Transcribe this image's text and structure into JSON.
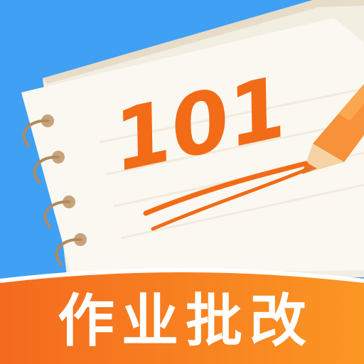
{
  "app_icon": {
    "score_text": "101",
    "banner_text": "作业批改",
    "colors": {
      "background": "#3fa0f4",
      "paper": "#fbf8f1",
      "paper_back": "#f3eee2",
      "score": "#f26b17",
      "banner_start": "#f46a1e",
      "banner_end": "#fb9623",
      "ring": "#c8a27a",
      "pencil_body": "#f7913a",
      "pencil_wood": "#f6d3a3"
    },
    "icons": [
      "spiral-binding-icon",
      "pencil-icon"
    ]
  }
}
